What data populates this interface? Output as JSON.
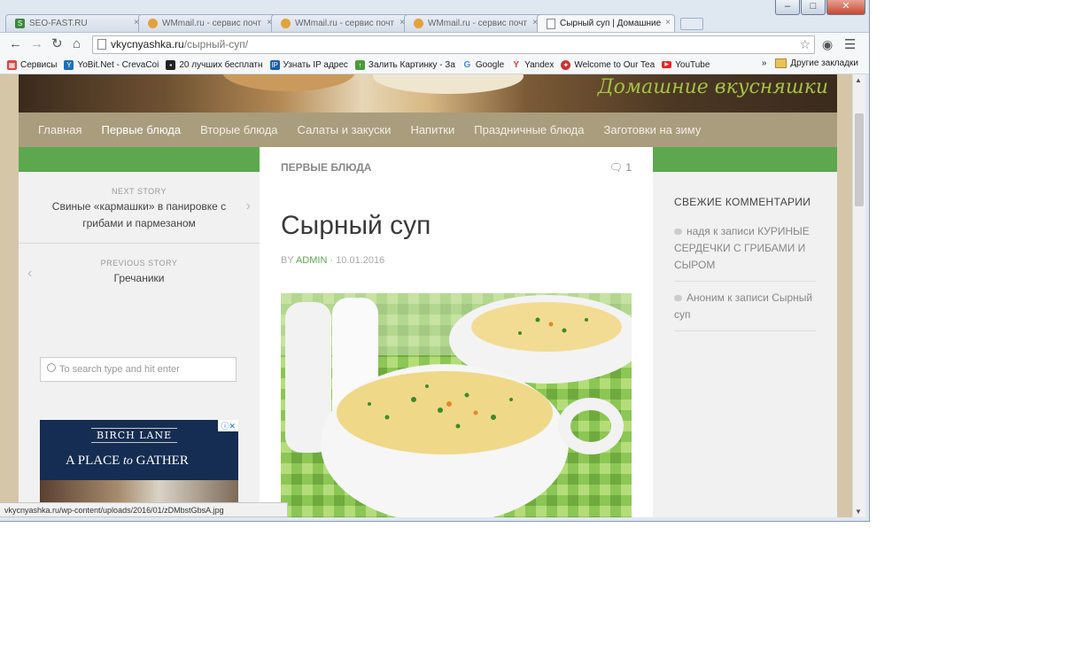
{
  "browser": {
    "tabs": [
      {
        "title": "SEO-FAST.RU",
        "favicon_color": "#3a8a3a",
        "favicon_glyph": "S"
      },
      {
        "title": "WMmail.ru - сервис почт",
        "favicon_color": "#e3a23a",
        "favicon_glyph": "W"
      },
      {
        "title": "WMmail.ru - сервис почт",
        "favicon_color": "#e3a23a",
        "favicon_glyph": "W"
      },
      {
        "title": "WMmail.ru - сервис почт",
        "favicon_color": "#e3a23a",
        "favicon_glyph": "W"
      },
      {
        "title": "Сырный суп | Домашние",
        "favicon_color": "#ffffff",
        "favicon_glyph": "page",
        "active": true
      }
    ],
    "url_host": "vkycnyashka.ru",
    "url_path": "/сырный-суп/",
    "bookmarks": [
      {
        "label": "Сервисы",
        "icon": "apps-icon",
        "color": "#d44"
      },
      {
        "label": "YoBit.Net - CrevaCoi",
        "icon": "yobit-icon",
        "color": "#1d6fb8"
      },
      {
        "label": "20 лучших бесплатн",
        "icon": "list-icon",
        "color": "#222"
      },
      {
        "label": "Узнать IP адрес",
        "icon": "ip-icon",
        "color": "#1b5fa8"
      },
      {
        "label": "Залить Картинку - За",
        "icon": "upload-icon",
        "color": "#4a9a3a"
      },
      {
        "label": "Google",
        "icon": "google-icon",
        "color": "#4285f4"
      },
      {
        "label": "Yandex",
        "icon": "yandex-icon",
        "color": "#e33"
      },
      {
        "label": "Welcome to Our Tea",
        "icon": "team-icon",
        "color": "#c33"
      },
      {
        "label": "YouTube",
        "icon": "youtube-icon",
        "color": "#e22"
      }
    ],
    "more_bookmarks": "»",
    "other_bookmarks": "Другие закладки",
    "status_url": "vkycnyashka.ru/wp-content/uploads/2016/01/zDMbstGbsA.jpg"
  },
  "site": {
    "tagline": "Домашние вкусняшки",
    "nav": [
      "Главная",
      "Первые блюда",
      "Вторые блюда",
      "Салаты и закуски",
      "Напитки",
      "Праздничные блюда",
      "Заготовки на зиму"
    ],
    "nav_active_index": 1
  },
  "left": {
    "next_label": "NEXT STORY",
    "next_title": "Свиные «кармашки» в панировке с грибами и пармезаном",
    "prev_label": "PREVIOUS STORY",
    "prev_title": "Гречаники",
    "search_placeholder": "To search type and hit enter",
    "ad": {
      "brand": "BIRCH LANE",
      "slogan_1": "A PLACE",
      "slogan_2": "to",
      "slogan_3": "GATHER"
    }
  },
  "post": {
    "category": "ПЕРВЫЕ БЛЮДА",
    "comments_count": "1",
    "title": "Сырный суп",
    "by": "BY",
    "author": "ADMIN",
    "date": " · 10.01.2016"
  },
  "right": {
    "heading": "СВЕЖИЕ КОММЕНТАРИИ",
    "comments": [
      "надя к записи КУРИНЫЕ СЕРДЕЧКИ С ГРИБАМИ И СЫРОМ",
      "Аноним к записи Сырный суп"
    ]
  }
}
